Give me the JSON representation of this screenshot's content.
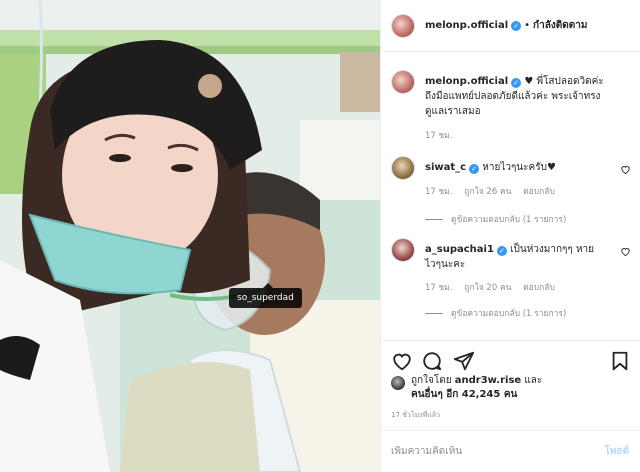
{
  "post": {
    "username": "melonp.official",
    "follow_label": "กำลังติดตาม",
    "dot": "•",
    "verified_mark": "✓",
    "photo_tag": "so_superdad"
  },
  "caption": {
    "username": "melonp.official",
    "text_line1": "♥ พี่โสปลอดวิดค่ะ",
    "text_line2": "ถึงมือแพทย์ปลอดภัยดีแล้วค่ะ พระเจ้าทรง",
    "text_line3": "ดูแลเราเสมอ",
    "time": "17 ชม."
  },
  "comments": [
    {
      "username": "siwat_c",
      "text": "หายไวๆนะครับ♥",
      "time": "17 ชม.",
      "likes": "ถูกใจ 26 คน",
      "reply": "ตอบกลับ",
      "view_replies": "ดูข้อความตอบกลับ (1 รายการ)"
    },
    {
      "username": "a_supachai1",
      "text_line1": "เป็นห่วงมากๆๆ หาย",
      "text_line2": "ไวๆนะคะ",
      "time": "17 ชม.",
      "likes": "ถูกใจ 20 คน",
      "reply": "ตอบกลับ",
      "view_replies": "ดูข้อความตอบกลับ (1 รายการ)"
    }
  ],
  "likes": {
    "prefix": "ถูกใจโดย",
    "liker": "andr3w.rise",
    "and": "และ",
    "others": "คนอื่นๆ อีก 42,245 คน"
  },
  "timestamp": "17 ชั่วโมงที่แล้ว",
  "add_comment": {
    "placeholder": "เพิ่มความคิดเห็น",
    "post_label": "โพสต์"
  },
  "colors": {
    "verified": "#3897f0",
    "post_button": "#b3dbff",
    "secondary_text": "#8e8e8e"
  },
  "icons": {
    "like": "heart-icon",
    "comment": "comment-icon",
    "share": "paper-plane-icon",
    "save": "bookmark-icon"
  }
}
